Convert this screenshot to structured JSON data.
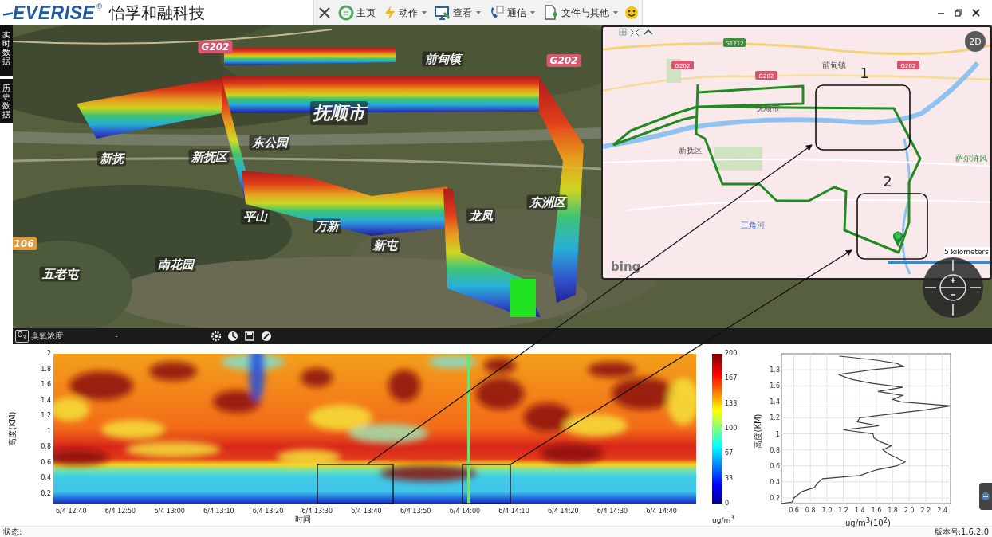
{
  "app": {
    "logo": "EVERISE",
    "logo_mark": "®",
    "company": "怡孚和融科技"
  },
  "toolbar": [
    {
      "label": "主页",
      "dropdown": false
    },
    {
      "label": "动作",
      "dropdown": true
    },
    {
      "label": "查看",
      "dropdown": true
    },
    {
      "label": "通信",
      "dropdown": true
    },
    {
      "label": "文件与其他",
      "dropdown": true
    }
  ],
  "side_tabs": [
    {
      "label": "实时数据",
      "selected": false
    },
    {
      "label": "历史数据",
      "selected": false
    }
  ],
  "satellite_map": {
    "labels": [
      {
        "text": "G202",
        "kind": "shield",
        "color": "#d9566e"
      },
      {
        "text": "G202",
        "kind": "shield",
        "color": "#d9566e"
      },
      {
        "text": "前甸镇",
        "kind": "place"
      },
      {
        "text": "抚顺市",
        "kind": "city"
      },
      {
        "text": "新抚",
        "kind": "place"
      },
      {
        "text": "新抚区",
        "kind": "place"
      },
      {
        "text": "东公园",
        "kind": "place"
      },
      {
        "text": "平山",
        "kind": "place"
      },
      {
        "text": "万新",
        "kind": "place"
      },
      {
        "text": "新屯",
        "kind": "place"
      },
      {
        "text": "龙凤",
        "kind": "place"
      },
      {
        "text": "东洲区",
        "kind": "place"
      },
      {
        "text": "五老屯",
        "kind": "place"
      },
      {
        "text": "南花园",
        "kind": "place"
      },
      {
        "text": "106",
        "kind": "shield",
        "color": "#e39a3c"
      }
    ]
  },
  "layer_bar": {
    "symbol": "O$_{3}$",
    "layer": "臭氧浓度",
    "value": "-"
  },
  "inset_map": {
    "view_button": "2D",
    "labels": [
      {
        "text": "G1212",
        "kind": "shield",
        "color": "#3f8f3f"
      },
      {
        "text": "G202",
        "kind": "shield",
        "color": "#d9566e"
      },
      {
        "text": "G202",
        "kind": "shield",
        "color": "#d9566e"
      },
      {
        "text": "前甸镇",
        "kind": "small"
      },
      {
        "text": "G202",
        "kind": "shield",
        "color": "#d9566e"
      },
      {
        "text": "抚顺市",
        "kind": "place"
      },
      {
        "text": "新抚区",
        "kind": "place"
      },
      {
        "text": "三角河",
        "kind": "water"
      },
      {
        "text": "萨尔浒风",
        "kind": "park"
      }
    ],
    "regions": [
      {
        "label": "1"
      },
      {
        "label": "2"
      }
    ],
    "scale": "5 kilometers",
    "brand": "bing"
  },
  "heatmap": {
    "ylabel": "高度(KM)",
    "yticks": [
      "2",
      "1.8",
      "1.6",
      "1.4",
      "1.2",
      "1",
      "0.8",
      "0.6",
      "0.4",
      "0.2"
    ],
    "xticks": [
      "6/4 12:40",
      "6/4 12:50",
      "6/4 13:00",
      "6/4 13:10",
      "6/4 13:20",
      "6/4 13:30",
      "6/4 13:40",
      "6/4 13:50",
      "6/4 14:00",
      "6/4 14:10",
      "6/4 14:20",
      "6/4 14:30",
      "6/4 14:40"
    ],
    "xlabel": "时间",
    "colorbar_ticks": [
      "200",
      "167",
      "133",
      "100",
      "67",
      "33",
      "0"
    ],
    "unit": "ug/m$^{3}$"
  },
  "profile": {
    "chart_data": {
      "type": "line",
      "xlabel": "ug/m$^{3}$(10$^{2}$)",
      "ylabel": "高度(KM)",
      "x": [
        0.45,
        0.58,
        0.6,
        0.7,
        0.85,
        0.88,
        0.95,
        1.4,
        1.6,
        1.85,
        1.95,
        1.85,
        1.75,
        1.68,
        1.78,
        1.65,
        1.57,
        1.56,
        1.2,
        1.63,
        1.37,
        1.4,
        1.8,
        2.2,
        2.5,
        1.9,
        1.8,
        1.92,
        1.62,
        1.92,
        1.55,
        1.3,
        1.14,
        1.55,
        1.93,
        1.85,
        1.6,
        1.25,
        1.15
      ],
      "series": [
        {
          "color": "#404040",
          "values": [
            0.13,
            0.15,
            0.2,
            0.28,
            0.33,
            0.38,
            0.44,
            0.48,
            0.55,
            0.6,
            0.65,
            0.7,
            0.75,
            0.8,
            0.85,
            0.9,
            0.95,
            1.0,
            1.05,
            1.1,
            1.15,
            1.2,
            1.25,
            1.3,
            1.35,
            1.4,
            1.43,
            1.48,
            1.53,
            1.58,
            1.63,
            1.68,
            1.74,
            1.8,
            1.84,
            1.88,
            1.92,
            1.96,
            1.97
          ]
        }
      ],
      "xlim": [
        0.45,
        2.5
      ],
      "ylim": [
        0.13,
        2.0
      ],
      "xticks": [
        0.6,
        0.8,
        {
          "value": 1,
          "label": "1.0"
        },
        1.2,
        1.4,
        1.6,
        1.8,
        {
          "value": 2,
          "label": "2.0"
        },
        2.2,
        2.4
      ],
      "yticks": [
        0.2,
        0.4,
        0.6,
        0.8,
        1,
        1.2,
        1.4,
        1.6,
        1.8
      ],
      "grid": true
    }
  },
  "status_bar": {
    "status": "状态:",
    "version": "版本号:1.6.2.0"
  }
}
